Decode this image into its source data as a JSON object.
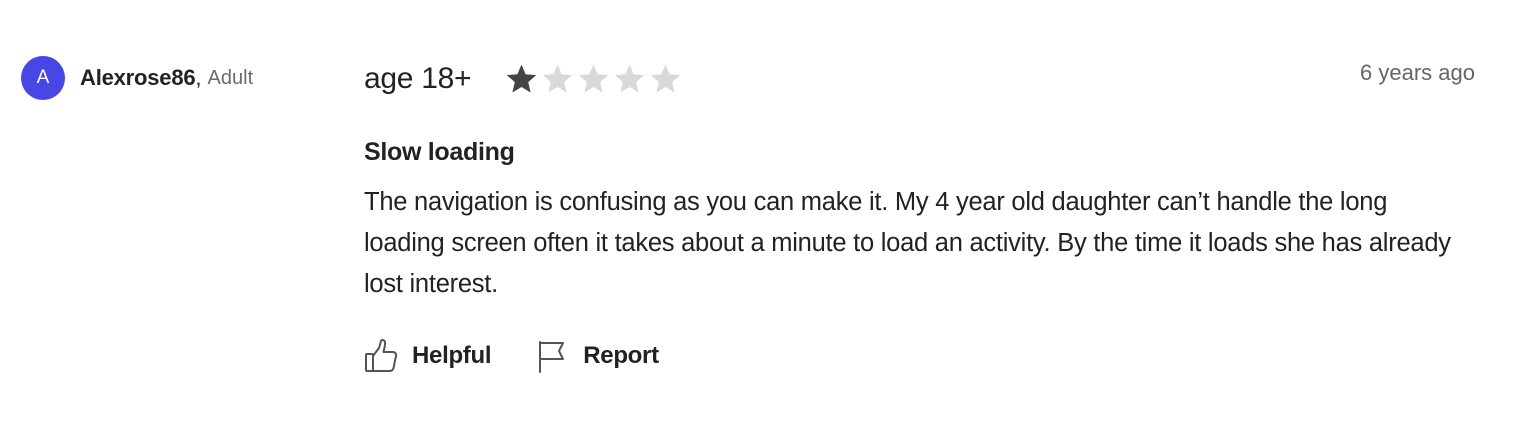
{
  "reviewer": {
    "avatar_initial": "A",
    "name": "Alexrose86",
    "separator": ",",
    "type": "Adult",
    "avatar_color": "#4747e6"
  },
  "review": {
    "age_label": "age 18+",
    "rating": 1,
    "rating_max": 5,
    "star_filled_color": "#444444",
    "star_empty_color": "#d9d9d9",
    "timestamp": "6 years ago",
    "title": "Slow loading",
    "body": "The navigation is confusing as you can make it. My 4 year old daughter can’t handle the long loading screen often it takes about a minute to load an activity. By the time it loads she has already lost interest."
  },
  "actions": {
    "helpful_label": "Helpful",
    "helpful_icon": "thumbs-up-icon",
    "report_label": "Report",
    "report_icon": "flag-icon"
  }
}
